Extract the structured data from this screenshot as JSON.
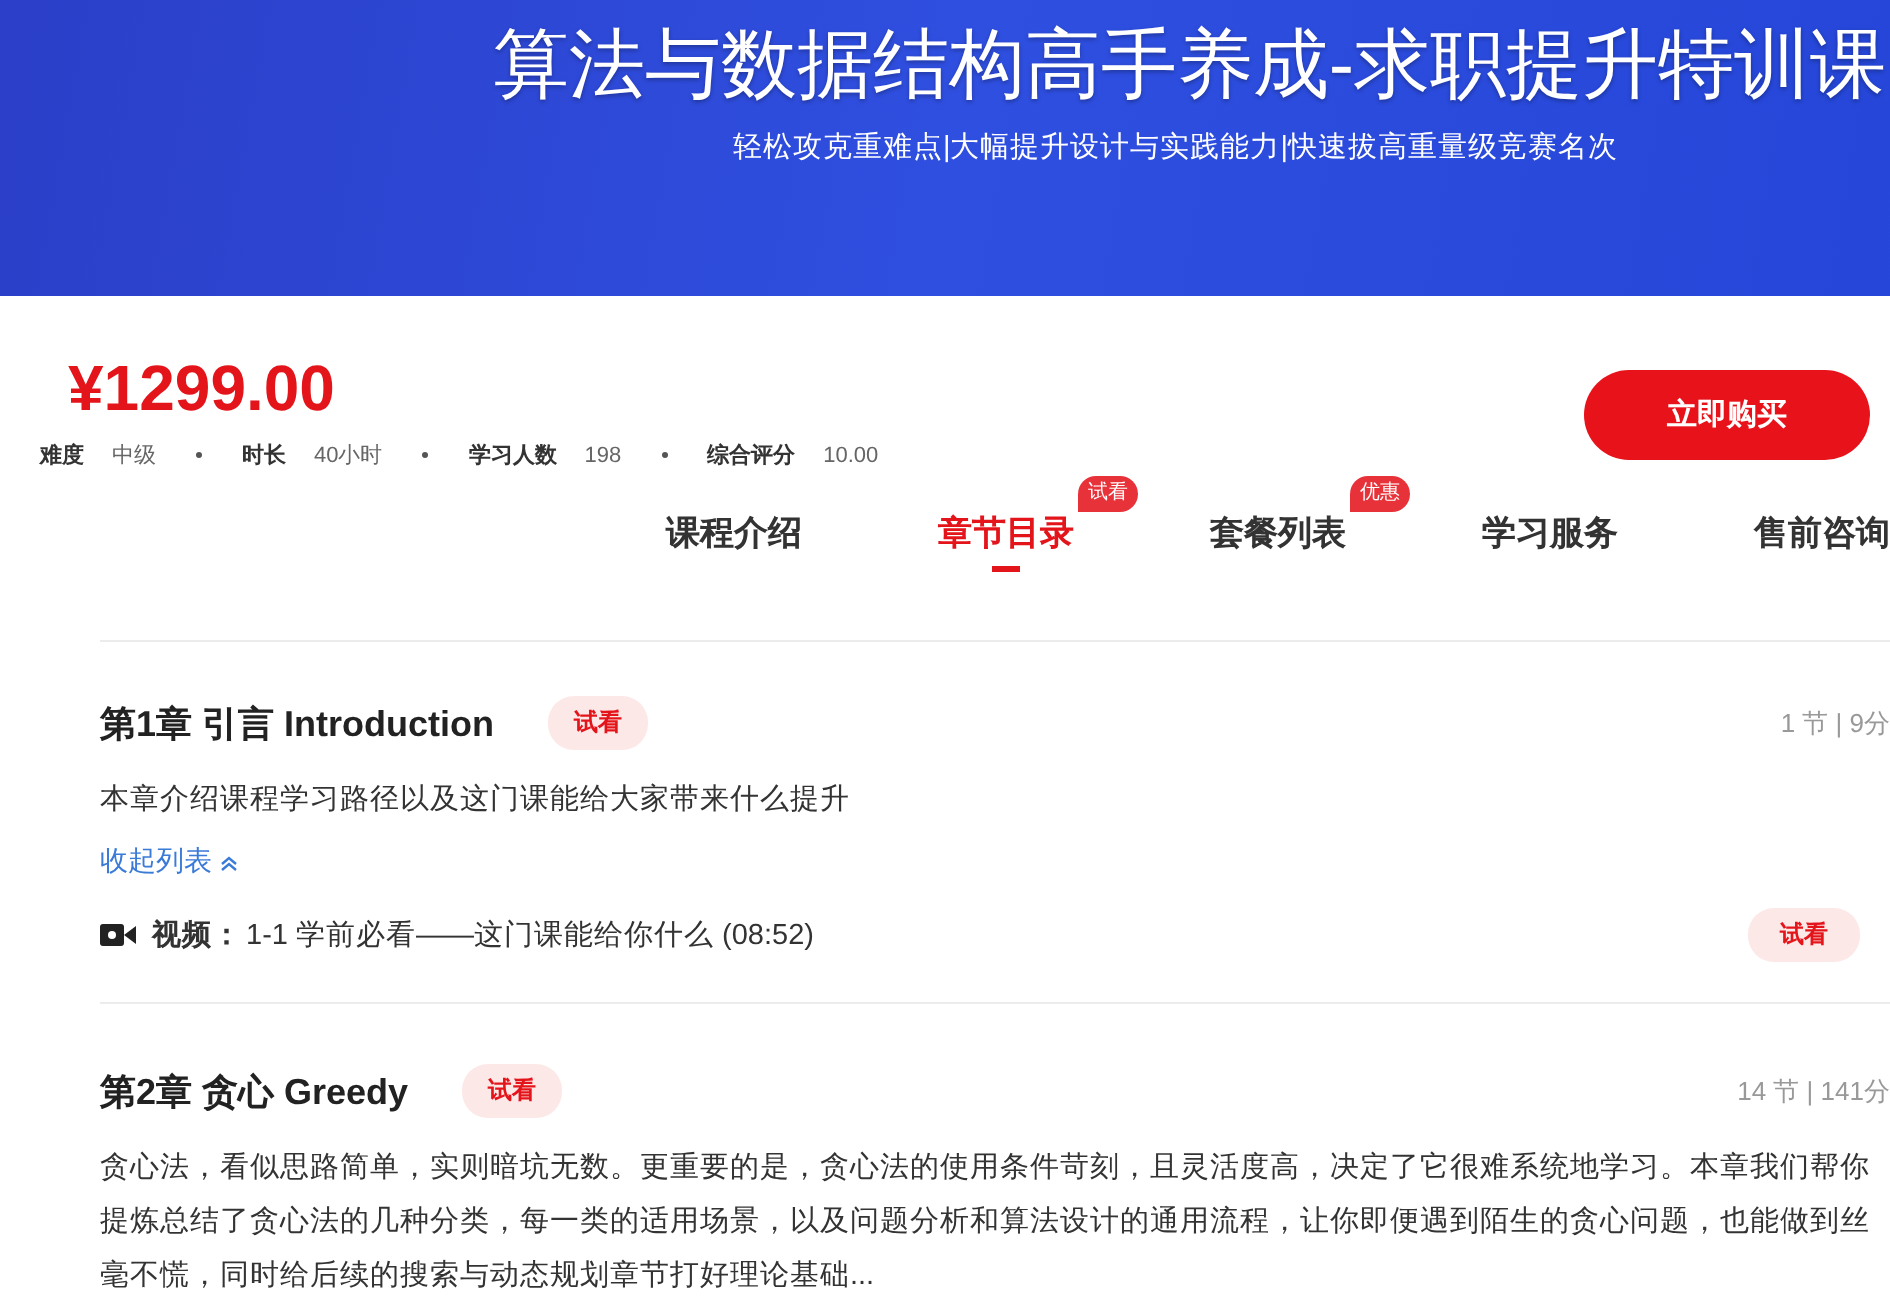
{
  "banner": {
    "title": "算法与数据结构高手养成-求职提升特训课",
    "subtitle": "轻松攻克重难点|大幅提升设计与实践能力|快速拔高重量级竞赛名次"
  },
  "price": "¥1299.00",
  "stats": [
    {
      "label": "难度",
      "value": "中级"
    },
    {
      "label": "时长",
      "value": "40小时"
    },
    {
      "label": "学习人数",
      "value": "198"
    },
    {
      "label": "综合评分",
      "value": "10.00"
    }
  ],
  "buy_button": "立即购买",
  "tabs": [
    {
      "label": "课程介绍",
      "selected": false
    },
    {
      "label": "章节目录",
      "selected": true,
      "badge": "试看"
    },
    {
      "label": "套餐列表",
      "selected": false,
      "badge": "优惠"
    },
    {
      "label": "学习服务",
      "selected": false
    },
    {
      "label": "售前咨询",
      "selected": false
    }
  ],
  "chapters": [
    {
      "title": "第1章 引言 Introduction",
      "tag": "试看",
      "meta": "1 节 | 9分",
      "description": "本章介绍课程学习路径以及这门课能给大家带来什么提升",
      "toggle": "收起列表",
      "expanded": true,
      "lessons": [
        {
          "type_label": "视频：",
          "title": "1-1 学前必看——这门课能给你什么 (08:52)",
          "action": "试看"
        }
      ]
    },
    {
      "title": "第2章 贪心 Greedy",
      "tag": "试看",
      "meta": "14 节 | 141分",
      "description": "贪心法，看似思路简单，实则暗坑无数。更重要的是，贪心法的使用条件苛刻，且灵活度高，决定了它很难系统地学习。本章我们帮你提炼总结了贪心法的几种分类，每一类的适用场景，以及问题分析和算法设计的通用流程，让你即便遇到陌生的贪心问题，也能做到丝毫不慌，同时给后续的搜索与动态规划章节打好理论基础..."
    }
  ]
}
